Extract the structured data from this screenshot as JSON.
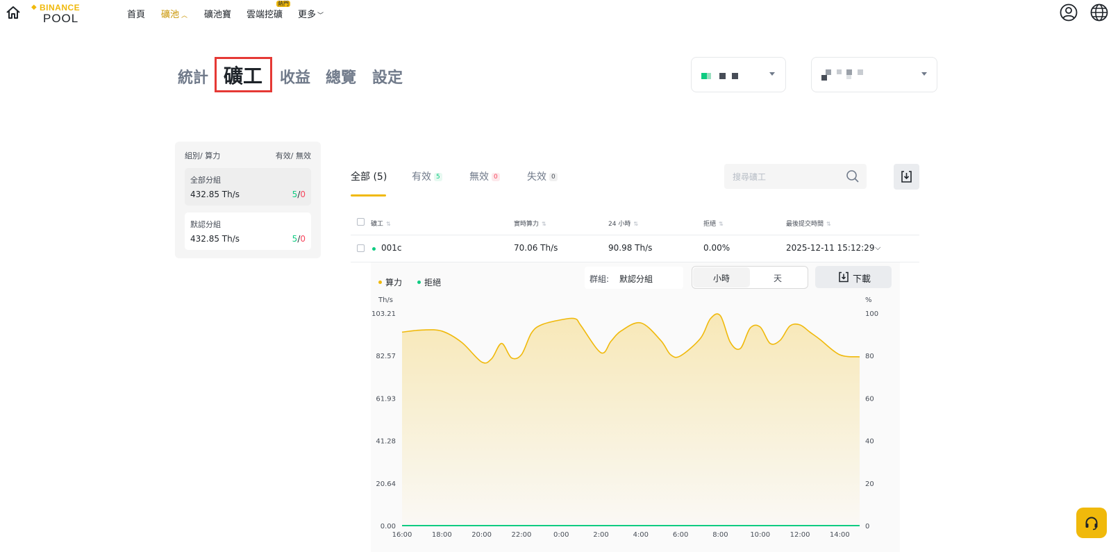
{
  "nav": {
    "logo_top": "BINANCE",
    "logo_bottom": "POOL",
    "items": [
      "首頁",
      "礦池",
      "礦池寶",
      "雲端挖礦",
      "更多"
    ],
    "hot_badge": "熱門"
  },
  "page_tabs": [
    "統計",
    "礦工",
    "收益",
    "總覽",
    "設定"
  ],
  "groups": {
    "header_left": "組別/ 算力",
    "header_right": "有效/ 無效",
    "items": [
      {
        "name": "全部分組",
        "hashrate": "432.85 Th/s",
        "active": "5",
        "slash": "/",
        "inactive": "0"
      },
      {
        "name": "默認分組",
        "hashrate": "432.85 Th/s",
        "active": "5",
        "slash": "/",
        "inactive": "0"
      }
    ]
  },
  "worker_tabs": [
    {
      "label": "全部 (5)"
    },
    {
      "label": "有效",
      "count": "5"
    },
    {
      "label": "無效",
      "count": "0"
    },
    {
      "label": "失效",
      "count": "0"
    }
  ],
  "search": {
    "placeholder": "搜尋礦工"
  },
  "table": {
    "headers": [
      "礦工",
      "實時算力",
      "24 小時",
      "拒絕",
      "最後提交時間"
    ],
    "rows": [
      {
        "worker": "001c",
        "realtime": "70.06 Th/s",
        "h24": "90.98 Th/s",
        "reject": "0.00%",
        "last_submit": "2025-12-11 15:12:29"
      }
    ]
  },
  "chart_controls": {
    "legend_hashrate": "算力",
    "legend_reject": "拒絕",
    "group_label": "群組:",
    "group_value": "默認分組",
    "toggle_hour": "小時",
    "toggle_day": "天",
    "download": "下載"
  },
  "colors": {
    "accent": "#F0B90B",
    "hashrate_line": "#F0B90B",
    "reject_line": "#0ecb81",
    "highlight_box": "#e53935"
  },
  "chart_data": {
    "type": "area",
    "ylabel_left": "Th/s",
    "ylabel_right": "%",
    "y_ticks_left": [
      "103.21",
      "82.57",
      "61.93",
      "41.28",
      "20.64",
      "0.00"
    ],
    "y_ticks_right": [
      "100",
      "80",
      "60",
      "40",
      "20",
      "0"
    ],
    "ylim_left": [
      0,
      103.21
    ],
    "ylim_right": [
      0,
      100
    ],
    "x_ticks": [
      "16:00",
      "18:00",
      "20:00",
      "22:00",
      "0:00",
      "2:00",
      "4:00",
      "6:00",
      "8:00",
      "10:00",
      "12:00",
      "14:00"
    ],
    "x_range_hours": [
      16,
      39
    ],
    "series": [
      {
        "name": "算力",
        "x_hours": [
          16,
          17,
          18,
          19,
          20,
          20.5,
          21,
          21.5,
          22,
          22.5,
          23,
          24,
          24.7,
          25,
          26,
          26.5,
          27,
          28,
          29,
          29.5,
          30,
          31,
          31.5,
          32,
          32.5,
          33,
          33.5,
          34,
          34.5,
          35,
          35.5,
          36,
          36.5,
          37,
          38,
          39
        ],
        "values": [
          94,
          95,
          94.5,
          89,
          79.5,
          81,
          88.5,
          81.5,
          83,
          93.5,
          97.5,
          100,
          100.5,
          97,
          84,
          89.5,
          94.5,
          98.5,
          90,
          83,
          82.5,
          91,
          100.5,
          102,
          89,
          86,
          96,
          96.5,
          88.5,
          90,
          97,
          97.5,
          94,
          90.5,
          83,
          82
        ]
      },
      {
        "name": "拒絕",
        "x_hours": [
          16,
          39
        ],
        "values": [
          0,
          0
        ]
      }
    ]
  }
}
